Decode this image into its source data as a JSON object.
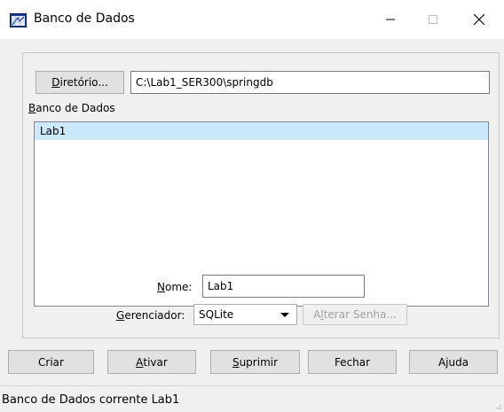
{
  "window": {
    "title": "Banco de Dados",
    "minimize": "—",
    "maximize": "☐",
    "close": "✕"
  },
  "directory": {
    "button_label": "Diretório...",
    "button_mnemonic": "D",
    "button_rest": "iretório...",
    "path": "C:\\Lab1_SER300\\springdb"
  },
  "db_list": {
    "label_mnemonic": "B",
    "label_rest": "anco de Dados",
    "items": [
      "Lab1"
    ],
    "selected": "Lab1"
  },
  "form": {
    "name_label_mnemonic": "N",
    "name_label_rest": "ome:",
    "name_value": "Lab1",
    "manager_label_mnemonic": "G",
    "manager_label_rest": "erenciador:",
    "manager_value": "SQLite",
    "alter_prefix": "A",
    "alter_mnemonic": "l",
    "alter_rest": "terar Senha..."
  },
  "buttons": {
    "criar": "Criar",
    "ativar_mnemonic": "A",
    "ativar_rest": "tivar",
    "suprimir_mnemonic": "S",
    "suprimir_rest": "uprimir",
    "fechar": "Fechar",
    "ajuda": "Ajuda"
  },
  "status": {
    "text": "Banco de Dados corrente Lab1"
  },
  "colors": {
    "selection": "#cce8ff",
    "panel": "#f0f0f0",
    "button_face": "#e1e1e1"
  }
}
